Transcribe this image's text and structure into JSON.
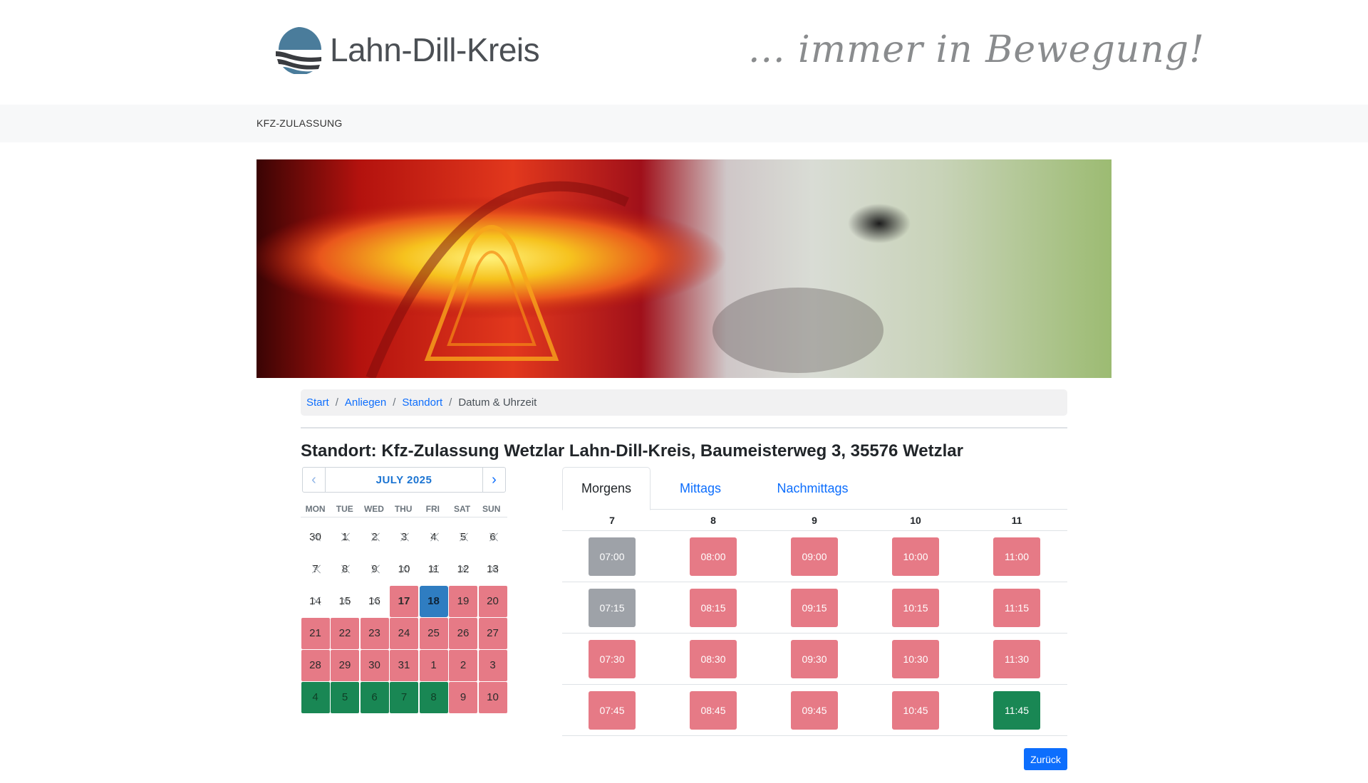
{
  "header": {
    "logo_text": "Lahn-Dill-Kreis",
    "slogan": "... immer in Bewegung!"
  },
  "navbar": {
    "item": "KFZ-ZULASSUNG"
  },
  "breadcrumb": {
    "items": [
      "Start",
      "Anliegen",
      "Standort"
    ],
    "current": "Datum & Uhrzeit"
  },
  "title": "Standort: Kfz-Zulassung Wetzlar Lahn-Dill-Kreis, Baumeisterweg 3, 35576 Wetzlar",
  "calendar": {
    "month": "JULY 2025",
    "prev_icon": "‹",
    "next_icon": "›",
    "weekdays": [
      "MON",
      "TUE",
      "WED",
      "THU",
      "FRI",
      "SAT",
      "SUN"
    ],
    "days": [
      {
        "label": "30",
        "state": "past"
      },
      {
        "label": "1",
        "state": "past"
      },
      {
        "label": "2",
        "state": "past"
      },
      {
        "label": "3",
        "state": "past"
      },
      {
        "label": "4",
        "state": "past"
      },
      {
        "label": "5",
        "state": "past"
      },
      {
        "label": "6",
        "state": "past"
      },
      {
        "label": "7",
        "state": "past"
      },
      {
        "label": "8",
        "state": "past"
      },
      {
        "label": "9",
        "state": "past"
      },
      {
        "label": "10",
        "state": "past"
      },
      {
        "label": "11",
        "state": "past"
      },
      {
        "label": "12",
        "state": "past"
      },
      {
        "label": "13",
        "state": "past"
      },
      {
        "label": "14",
        "state": "past"
      },
      {
        "label": "15",
        "state": "past"
      },
      {
        "label": "16",
        "state": "past"
      },
      {
        "label": "17",
        "state": "today-full"
      },
      {
        "label": "18",
        "state": "selected"
      },
      {
        "label": "19",
        "state": "full"
      },
      {
        "label": "20",
        "state": "full"
      },
      {
        "label": "21",
        "state": "full"
      },
      {
        "label": "22",
        "state": "full"
      },
      {
        "label": "23",
        "state": "full"
      },
      {
        "label": "24",
        "state": "full"
      },
      {
        "label": "25",
        "state": "full"
      },
      {
        "label": "26",
        "state": "full"
      },
      {
        "label": "27",
        "state": "full"
      },
      {
        "label": "28",
        "state": "full"
      },
      {
        "label": "29",
        "state": "full"
      },
      {
        "label": "30",
        "state": "full"
      },
      {
        "label": "31",
        "state": "full"
      },
      {
        "label": "1",
        "state": "full"
      },
      {
        "label": "2",
        "state": "full"
      },
      {
        "label": "3",
        "state": "full"
      },
      {
        "label": "4",
        "state": "free"
      },
      {
        "label": "5",
        "state": "free"
      },
      {
        "label": "6",
        "state": "free"
      },
      {
        "label": "7",
        "state": "free"
      },
      {
        "label": "8",
        "state": "free"
      },
      {
        "label": "9",
        "state": "full"
      },
      {
        "label": "10",
        "state": "full"
      }
    ]
  },
  "tabs": [
    {
      "label": "Morgens",
      "active": true
    },
    {
      "label": "Mittags",
      "active": false
    },
    {
      "label": "Nachmittags",
      "active": false
    }
  ],
  "hours": [
    "7",
    "8",
    "9",
    "10",
    "11"
  ],
  "slots": [
    [
      {
        "t": "07:00",
        "s": "past"
      },
      {
        "t": "08:00",
        "s": "full"
      },
      {
        "t": "09:00",
        "s": "full"
      },
      {
        "t": "10:00",
        "s": "full"
      },
      {
        "t": "11:00",
        "s": "full"
      }
    ],
    [
      {
        "t": "07:15",
        "s": "past"
      },
      {
        "t": "08:15",
        "s": "full"
      },
      {
        "t": "09:15",
        "s": "full"
      },
      {
        "t": "10:15",
        "s": "full"
      },
      {
        "t": "11:15",
        "s": "full"
      }
    ],
    [
      {
        "t": "07:30",
        "s": "full"
      },
      {
        "t": "08:30",
        "s": "full"
      },
      {
        "t": "09:30",
        "s": "full"
      },
      {
        "t": "10:30",
        "s": "full"
      },
      {
        "t": "11:30",
        "s": "full"
      }
    ],
    [
      {
        "t": "07:45",
        "s": "full"
      },
      {
        "t": "08:45",
        "s": "full"
      },
      {
        "t": "09:45",
        "s": "full"
      },
      {
        "t": "10:45",
        "s": "full"
      },
      {
        "t": "11:45",
        "s": "free"
      }
    ]
  ],
  "back_button": "Zurück",
  "colors": {
    "full": "#e67a86",
    "free": "#198754",
    "past": "#9ea2a8",
    "selected": "#2f7dc1",
    "link": "#0d6efd"
  }
}
